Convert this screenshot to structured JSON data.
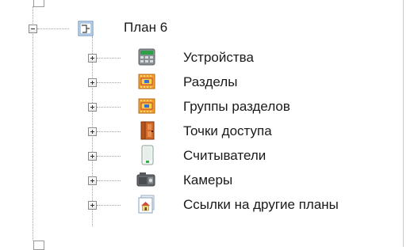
{
  "tree": {
    "plan": {
      "label": "План 6",
      "icon": "plan-icon",
      "expanded": true
    },
    "children": [
      {
        "label": "Устройства",
        "icon": "devices-icon"
      },
      {
        "label": "Разделы",
        "icon": "partitions-icon"
      },
      {
        "label": "Группы разделов",
        "icon": "partition-groups-icon"
      },
      {
        "label": "Точки доступа",
        "icon": "access-points-icon"
      },
      {
        "label": "Считыватели",
        "icon": "readers-icon"
      },
      {
        "label": "Камеры",
        "icon": "cameras-icon"
      },
      {
        "label": "Ссылки на другие планы",
        "icon": "plan-links-icon"
      }
    ]
  }
}
